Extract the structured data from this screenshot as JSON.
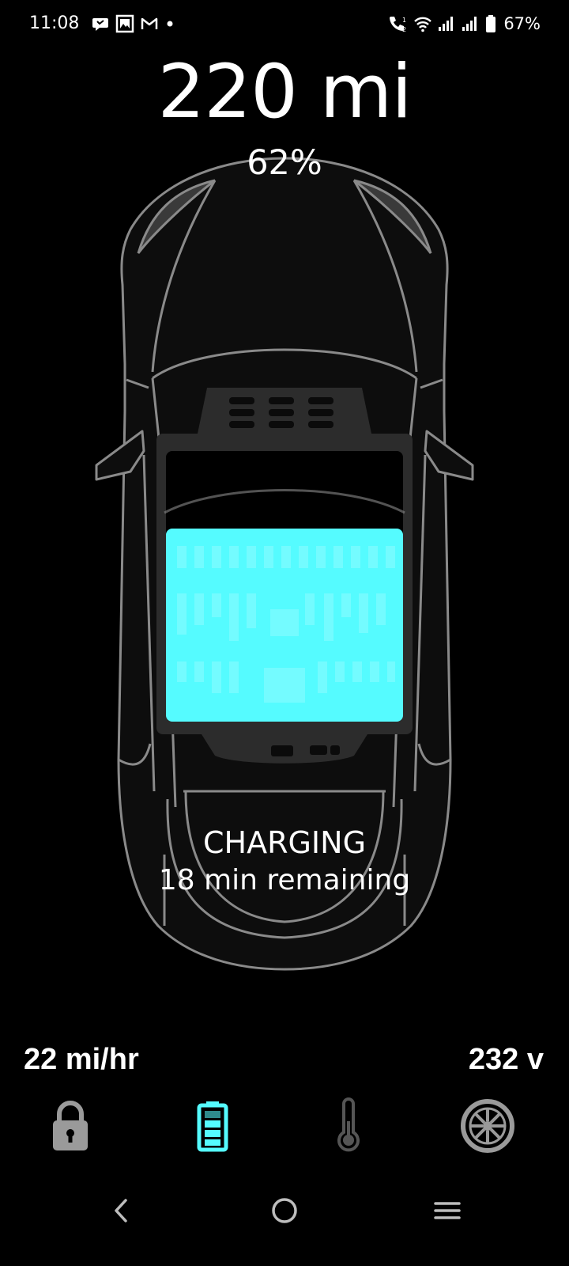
{
  "status_bar": {
    "time": "11:08",
    "left_icons": [
      "chat-bubble-icon",
      "photo-app-icon",
      "gmail-icon",
      "dot-icon"
    ],
    "right_icons": [
      "volte-call-icon",
      "wifi-icon",
      "signal-icon",
      "signal-icon",
      "battery-icon"
    ],
    "battery_percent": "67%"
  },
  "range": "220 mi",
  "charge_percent": "62%",
  "battery_level": 0.62,
  "charging": {
    "label": "CHARGING",
    "time_remaining": "18 min remaining"
  },
  "stats": {
    "rate": "22 mi/hr",
    "voltage": "232 v"
  },
  "tabs": [
    {
      "name": "lock-icon",
      "active": false
    },
    {
      "name": "battery-icon",
      "active": true
    },
    {
      "name": "thermometer-icon",
      "active": false
    },
    {
      "name": "wheel-icon",
      "active": false
    }
  ],
  "colors": {
    "accent": "#55FBFF",
    "car_outline": "#8a8a8a",
    "icon_inactive": "#9a9a9a",
    "background": "#000000"
  },
  "nav": [
    "back-icon",
    "home-icon",
    "recents-icon"
  ]
}
